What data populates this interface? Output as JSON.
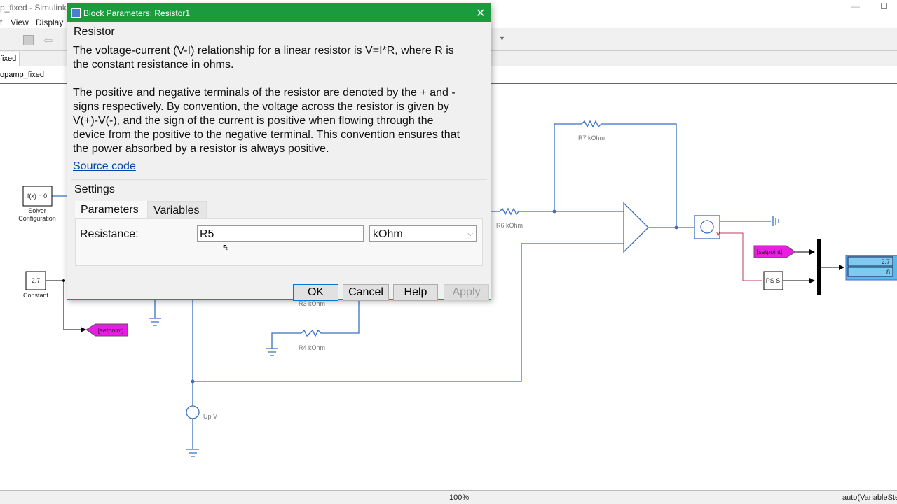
{
  "window": {
    "title": "p_fixed - Simulink",
    "menu": [
      "t",
      "View",
      "Display"
    ],
    "tab": "fixed",
    "address": "opamp_fixed"
  },
  "status": {
    "zoom": "100%",
    "solver": "auto(VariableStep"
  },
  "dialog": {
    "title": "Block Parameters: Resistor1",
    "block_name": "Resistor",
    "desc1_line1": "The voltage-current (V-I) relationship for a linear resistor is V=I*R, where R is",
    "desc1_line2": "the constant resistance in ohms.",
    "desc2_lines": [
      "The positive and negative terminals of the resistor are denoted by the + and -",
      "signs respectively. By convention, the voltage across the resistor is given by",
      "V(+)-V(-), and the sign of the current is positive when flowing through the",
      "device from the positive to the negative terminal. This convention ensures that",
      "the power absorbed by a resistor is always positive."
    ],
    "source_link": "Source code",
    "settings_label": "Settings",
    "tabs": [
      "Parameters",
      "Variables"
    ],
    "resistance_label": "Resistance:",
    "resistance_value": "R5",
    "unit_value": "kOhm",
    "buttons": {
      "ok": "OK",
      "cancel": "Cancel",
      "help": "Help",
      "apply": "Apply"
    }
  },
  "diagram": {
    "solver_block": "f(x) = 0",
    "solver_label1": "Solver",
    "solver_label2": "Configuration",
    "constant_value": "2.7",
    "constant_label": "Constant",
    "goto_tag": "[setpoint]",
    "from_tag": "[setpoint]",
    "r3": "R3 kOhm",
    "r4": "R4 kOhm",
    "r6": "R6 kOhm",
    "r7": "R7 kOhm",
    "source_label": "Up V",
    "sensor_label": "V",
    "ps_s": "PS S",
    "display_values": [
      "2.7",
      "8"
    ],
    "colors": {
      "wire": "#3b6fc4",
      "signal": "#000000",
      "tag": "#e81ee0",
      "display": "#5bb8e8",
      "dialog_title": "#1a9c3e",
      "link": "#0645ad"
    }
  }
}
